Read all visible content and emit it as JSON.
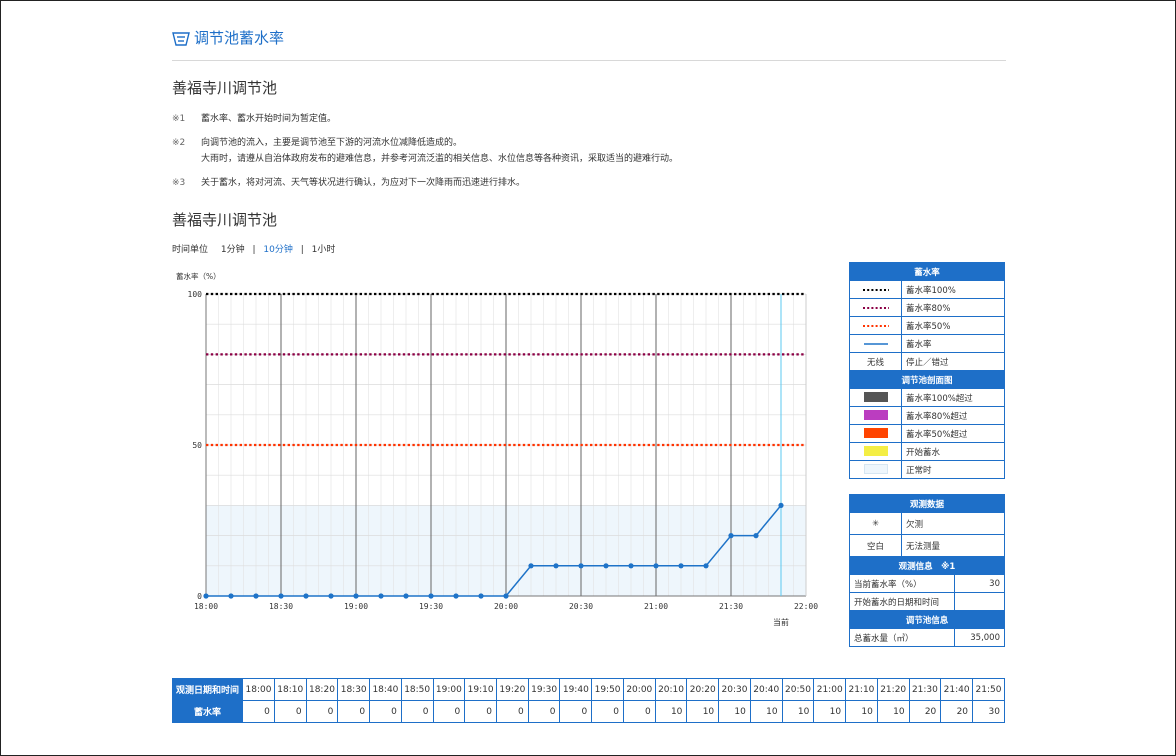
{
  "header": {
    "title": "调节池蓄水率",
    "icon": "list-icon"
  },
  "pond_name": "善福寺川调节池",
  "notes": [
    {
      "mark": "※1",
      "lines": [
        "蓄水率、蓄水开始时间为暂定值。"
      ]
    },
    {
      "mark": "※2",
      "lines": [
        "向调节池的流入，主要是调节池至下游的河流水位减降低造成的。",
        "大雨时，请遵从自治体政府发布的避难信息，并参考河流泛滥的相关信息、水位信息等各种资讯，采取适当的避难行动。"
      ]
    },
    {
      "mark": "※3",
      "lines": [
        "关于蓄水，将对河流、天气等状况进行确认，为应对下一次降雨而迅速进行排水。"
      ]
    }
  ],
  "time_unit": {
    "label": "时间单位",
    "options": [
      "1分钟",
      "10分钟",
      "1小时"
    ],
    "selected": "10分钟"
  },
  "chart_data": {
    "type": "line",
    "ylabel": "蓄水率（%）",
    "ylim": [
      0,
      100
    ],
    "yticks": [
      0,
      50,
      100
    ],
    "x_tick_labels": [
      "18:00",
      "18:30",
      "19:00",
      "19:30",
      "20:00",
      "20:30",
      "21:00",
      "21:30",
      "22:00"
    ],
    "x": [
      "18:00",
      "18:10",
      "18:20",
      "18:30",
      "18:40",
      "18:50",
      "19:00",
      "19:10",
      "19:20",
      "19:30",
      "19:40",
      "19:50",
      "20:00",
      "20:10",
      "20:20",
      "20:30",
      "20:40",
      "20:50",
      "21:00",
      "21:10",
      "21:20",
      "21:30",
      "21:40",
      "21:50"
    ],
    "series": [
      {
        "name": "蓄水率",
        "color": "#1e73c8",
        "values": [
          0,
          0,
          0,
          0,
          0,
          0,
          0,
          0,
          0,
          0,
          0,
          0,
          0,
          10,
          10,
          10,
          10,
          10,
          10,
          10,
          10,
          20,
          20,
          30
        ]
      }
    ],
    "reference_lines": [
      {
        "name": "蓄水率100%",
        "value": 100,
        "color": "#000000"
      },
      {
        "name": "蓄水率80%",
        "value": 80,
        "color": "#8b0045"
      },
      {
        "name": "蓄水率50%",
        "value": 50,
        "color": "#ff3300"
      }
    ],
    "normal_band": {
      "from": 0,
      "to": 30,
      "color": "#eef6fc"
    },
    "current_marker": {
      "x": "21:50",
      "label": "当前",
      "color": "#5bc8f0"
    },
    "grid": true
  },
  "legend": {
    "title": "蓄水率",
    "lines": [
      {
        "label": "蓄水率100%",
        "color": "#000000",
        "style": "dotted"
      },
      {
        "label": "蓄水率80%",
        "color": "#8b0045",
        "style": "dotted"
      },
      {
        "label": "蓄水率50%",
        "color": "#ff3300",
        "style": "dotted"
      },
      {
        "label": "蓄水率",
        "color": "#1e73c8",
        "style": "solid"
      }
    ],
    "no_line": {
      "symbol": "无线",
      "label": "停止／错过"
    },
    "section_title": "调节池剖面图",
    "section_items": [
      {
        "label": "蓄水率100%超过",
        "color": "#555555"
      },
      {
        "label": "蓄水率80%超过",
        "color": "#bb3dc0"
      },
      {
        "label": "蓄水率50%超过",
        "color": "#ff4400"
      },
      {
        "label": "开始蓄水",
        "color": "#f4ee44"
      },
      {
        "label": "正常时",
        "color": "#eef6fc"
      }
    ]
  },
  "observation": {
    "title": "观测数据",
    "items": [
      {
        "symbol": "✳",
        "label": "欠测"
      },
      {
        "symbol": "空白",
        "label": "无法测量"
      }
    ],
    "info_title": "观测信息　※1",
    "info_rows": [
      {
        "label": "当前蓄水率（%）",
        "value": "30"
      },
      {
        "label": "开始蓄水的日期和时间",
        "value": ""
      }
    ],
    "pond_info_title": "调节池信息",
    "pond_info_rows": [
      {
        "label": "总蓄水量（㎥）",
        "value": "35,000"
      }
    ]
  },
  "obs_table": {
    "time_header": "观测日期和时间",
    "value_header": "蓄水率",
    "times": [
      "18:00",
      "18:10",
      "18:20",
      "18:30",
      "18:40",
      "18:50",
      "19:00",
      "19:10",
      "19:20",
      "19:30",
      "19:40",
      "19:50",
      "20:00",
      "20:10",
      "20:20",
      "20:30",
      "20:40",
      "20:50",
      "21:00",
      "21:10",
      "21:20",
      "21:30",
      "21:40",
      "21:50"
    ],
    "values": [
      "0",
      "0",
      "0",
      "0",
      "0",
      "0",
      "0",
      "0",
      "0",
      "0",
      "0",
      "0",
      "0",
      "10",
      "10",
      "10",
      "10",
      "10",
      "10",
      "10",
      "10",
      "20",
      "20",
      "30"
    ]
  }
}
